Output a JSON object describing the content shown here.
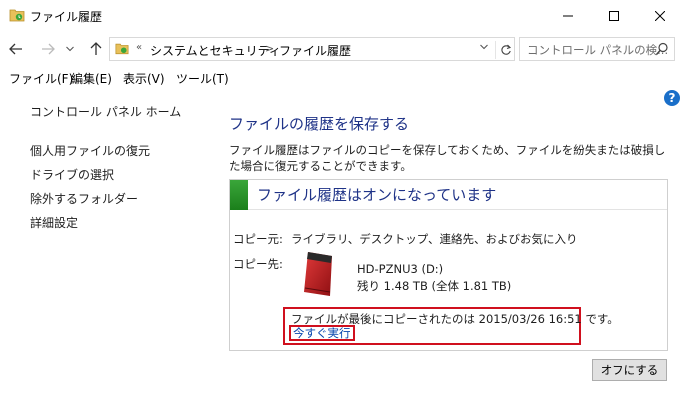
{
  "window": {
    "title": "ファイル履歴"
  },
  "address": {
    "chevron": "«",
    "crumbs": [
      "システムとセキュリティ",
      "ファイル履歴"
    ],
    "separator": ">"
  },
  "search": {
    "placeholder": "コントロール パネルの検..."
  },
  "menu": [
    "ファイル(F)",
    "編集(E)",
    "表示(V)",
    "ツール(T)"
  ],
  "leftnav": {
    "home": "コントロール パネル ホーム",
    "items": [
      "個人用ファイルの復元",
      "ドライブの選択",
      "除外するフォルダー",
      "詳細設定"
    ]
  },
  "main": {
    "title": "ファイルの履歴を保存する",
    "description": "ファイル履歴はファイルのコピーを保存しておくため、ファイルを紛失または破損した場合に復元することができます。"
  },
  "panel": {
    "status_title": "ファイル履歴はオンになっています",
    "copy_from_label": "コピー元:",
    "copy_from_value": "ライブラリ、デスクトップ、連絡先、およびお気に入り",
    "copy_to_label": "コピー先:",
    "drive_name": "HD-PZNU3 (D:)",
    "drive_space": "残り 1.48 TB (全体 1.81 TB)",
    "last_copy_text": "ファイルが最後にコピーされたのは 2015/03/26 16:51 です。",
    "run_now_link": "今すぐ実行"
  },
  "buttons": {
    "turn_off": "オフにする"
  },
  "colors": {
    "title_blue": "#1e3287",
    "status_green": "#2a922a",
    "highlight_red": "#d0101e",
    "link_blue": "#0645ad"
  }
}
